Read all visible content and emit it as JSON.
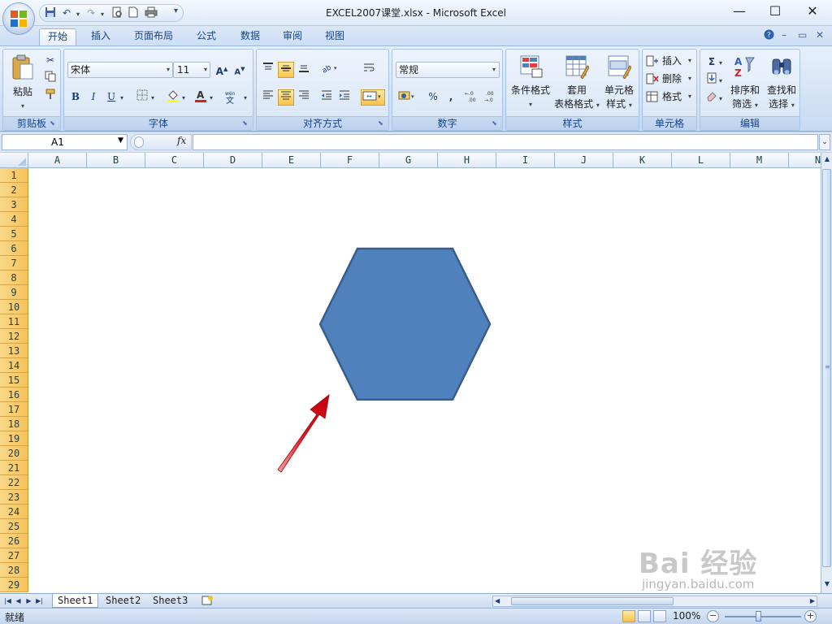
{
  "window": {
    "title": "EXCEL2007课堂.xlsx - Microsoft Excel",
    "controls": {
      "minimize": "—",
      "maximize": "☐",
      "close": "✕"
    }
  },
  "quick_access": {
    "items": [
      "save-icon",
      "undo-icon",
      "redo-icon",
      "print-preview-icon",
      "new-document-icon",
      "print-icon",
      "customize-dropdown-icon"
    ]
  },
  "ribbon_tabs": [
    {
      "label": "开始",
      "active": true
    },
    {
      "label": "插入",
      "active": false
    },
    {
      "label": "页面布局",
      "active": false
    },
    {
      "label": "公式",
      "active": false
    },
    {
      "label": "数据",
      "active": false
    },
    {
      "label": "审阅",
      "active": false
    },
    {
      "label": "视图",
      "active": false
    }
  ],
  "ribbon": {
    "clipboard": {
      "group_label": "剪贴板",
      "paste_label": "粘贴"
    },
    "font": {
      "group_label": "字体",
      "font_name": "宋体",
      "font_size": "11"
    },
    "alignment": {
      "group_label": "对齐方式"
    },
    "number": {
      "group_label": "数字",
      "format": "常规",
      "percent": "%",
      "comma": ","
    },
    "styles": {
      "group_label": "样式",
      "conditional_line1": "条件格式",
      "table_line1": "套用",
      "table_line2": "表格格式",
      "cell_style_line1": "单元格",
      "cell_style_line2": "样式"
    },
    "cells": {
      "group_label": "单元格",
      "insert": "插入",
      "delete": "删除",
      "format": "格式"
    },
    "editing": {
      "group_label": "编辑",
      "sort_line1": "排序和",
      "sort_line2": "筛选",
      "find_line1": "查找和",
      "find_line2": "选择"
    }
  },
  "formula_bar": {
    "name_box": "A1",
    "fx": "fx",
    "formula": ""
  },
  "grid": {
    "columns": [
      "A",
      "B",
      "C",
      "D",
      "E",
      "F",
      "G",
      "H",
      "I",
      "J",
      "K",
      "L",
      "M",
      "N"
    ],
    "rows": [
      "1",
      "2",
      "3",
      "4",
      "5",
      "6",
      "7",
      "8",
      "9",
      "10",
      "11",
      "12",
      "13",
      "14",
      "15",
      "16",
      "17",
      "18",
      "19",
      "20",
      "21",
      "22",
      "23",
      "24",
      "25",
      "26",
      "27",
      "28",
      "29"
    ],
    "shape": {
      "type": "hexagon",
      "fill": "#4f81bd",
      "stroke": "#385d8a"
    },
    "annotation_arrow_color": "#e0141e"
  },
  "sheets": [
    {
      "label": "Sheet1",
      "active": true
    },
    {
      "label": "Sheet2",
      "active": false
    },
    {
      "label": "Sheet3",
      "active": false
    }
  ],
  "status": {
    "text": "就绪",
    "zoom": "100%",
    "zoom_percent": 100
  },
  "watermark": {
    "brand": "Bai 经验",
    "url": "jingyan.baidu.com"
  },
  "colors": {
    "accent": "#15428b",
    "ribbon": "#dbe7f7",
    "row_header": "#f6c25a"
  }
}
